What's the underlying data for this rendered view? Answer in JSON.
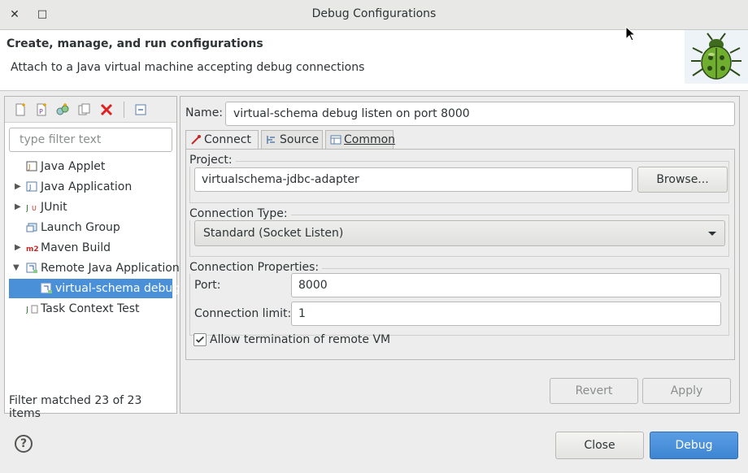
{
  "window": {
    "title": "Debug Configurations",
    "close_glyph": "✕",
    "maximize_glyph": "□"
  },
  "banner": {
    "heading": "Create, manage, and run configurations",
    "description": "Attach to a Java virtual machine accepting debug connections",
    "icon": "bug-icon"
  },
  "left": {
    "toolbar_icons": [
      "new-configuration-icon",
      "new-prototype-icon",
      "export-icon",
      "duplicate-icon",
      "delete-icon",
      "collapse-all-icon"
    ],
    "filter_placeholder": "type filter text",
    "tree": [
      {
        "label": "Java Applet",
        "icon": "java-applet-icon",
        "expandable": false
      },
      {
        "label": "Java Application",
        "icon": "java-application-icon",
        "expandable": true,
        "expanded": false
      },
      {
        "label": "JUnit",
        "icon": "junit-icon",
        "expandable": true,
        "expanded": false
      },
      {
        "label": "Launch Group",
        "icon": "launch-group-icon",
        "expandable": false
      },
      {
        "label": "Maven Build",
        "icon": "maven-icon",
        "expandable": true,
        "expanded": false
      },
      {
        "label": "Remote Java Application",
        "icon": "remote-java-icon",
        "expandable": true,
        "expanded": true
      },
      {
        "label": "virtual-schema debug",
        "icon": "remote-config-icon",
        "selected": true,
        "child": true
      },
      {
        "label": "Task Context Test",
        "icon": "task-context-test-icon",
        "expandable": false
      }
    ],
    "status": "Filter matched 23 of 23 items"
  },
  "right": {
    "name_label": "Name:",
    "name_value": "virtual-schema debug listen on port 8000",
    "tabs": [
      {
        "label": "Connect",
        "icon": "connect-icon",
        "active": true
      },
      {
        "label": "Source",
        "icon": "source-icon",
        "active": false
      },
      {
        "label": "Common",
        "icon": "common-icon",
        "active": false
      }
    ],
    "project_label": "Project:",
    "project_value": "virtualschema-jdbc-adapter",
    "browse_label": "Browse...",
    "connection_type_label": "Connection Type:",
    "connection_type_value": "Standard (Socket Listen)",
    "connection_properties_label": "Connection Properties:",
    "port_label": "Port:",
    "port_value": "8000",
    "limit_label": "Connection limit:",
    "limit_value": "1",
    "allow_termination_label": "Allow termination of remote VM",
    "allow_termination_checked": true,
    "revert_label": "Revert",
    "apply_label": "Apply"
  },
  "footer": {
    "help_glyph": "?",
    "close_label": "Close",
    "debug_label": "Debug"
  }
}
